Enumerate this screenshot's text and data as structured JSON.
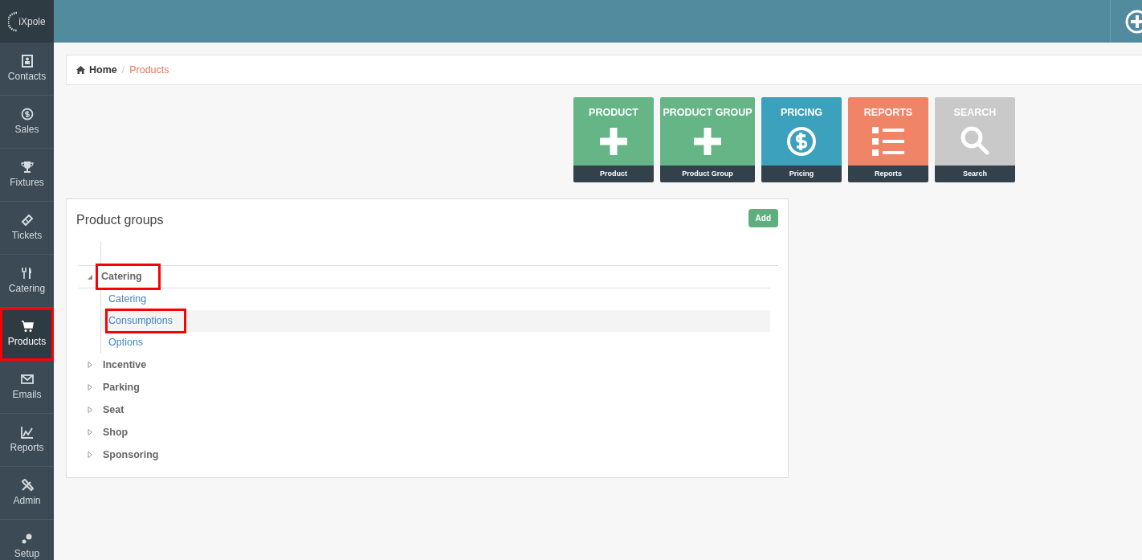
{
  "logo": {
    "text": "iXpole"
  },
  "sidebar": {
    "items": [
      {
        "label": "Contacts",
        "selected": false,
        "highlighted": false
      },
      {
        "label": "Sales",
        "selected": false,
        "highlighted": false
      },
      {
        "label": "Fixtures",
        "selected": false,
        "highlighted": false
      },
      {
        "label": "Tickets",
        "selected": false,
        "highlighted": false
      },
      {
        "label": "Catering",
        "selected": false,
        "highlighted": false
      },
      {
        "label": "Products",
        "selected": true,
        "highlighted": true
      },
      {
        "label": "Emails",
        "selected": false,
        "highlighted": false
      },
      {
        "label": "Reports",
        "selected": false,
        "highlighted": false
      },
      {
        "label": "Admin",
        "selected": false,
        "highlighted": false
      },
      {
        "label": "Setup",
        "selected": false,
        "highlighted": false
      }
    ]
  },
  "breadcrumb": {
    "separator": "/",
    "items": [
      {
        "label": "Home",
        "active": false
      },
      {
        "label": "Products",
        "active": true
      }
    ]
  },
  "tiles": [
    {
      "title": "PRODUCT",
      "caption": "Product",
      "kind": "plus",
      "color": "#66b587"
    },
    {
      "title": "PRODUCT GROUP",
      "caption": "Product Group",
      "kind": "plus",
      "color": "#66b587"
    },
    {
      "title": "PRICING",
      "caption": "Pricing",
      "kind": "dollar",
      "color": "#3ca1bc"
    },
    {
      "title": "REPORTS",
      "caption": "Reports",
      "kind": "list",
      "color": "#ef8466"
    },
    {
      "title": "SEARCH",
      "caption": "Search",
      "kind": "search",
      "color": "#c9c9c9"
    }
  ],
  "panel": {
    "title": "Product groups",
    "add_button": "Add",
    "tree": [
      {
        "label": "Catering",
        "expanded": true,
        "highlighted": true,
        "children": [
          {
            "label": "Catering",
            "selected": false,
            "highlighted": false
          },
          {
            "label": "Consumptions",
            "selected": true,
            "highlighted": true
          },
          {
            "label": "Options",
            "selected": false,
            "highlighted": false
          }
        ]
      },
      {
        "label": "Incentive",
        "expanded": false,
        "highlighted": false
      },
      {
        "label": "Parking",
        "expanded": false,
        "highlighted": false
      },
      {
        "label": "Seat",
        "expanded": false,
        "highlighted": false
      },
      {
        "label": "Shop",
        "expanded": false,
        "highlighted": false
      },
      {
        "label": "Sponsoring",
        "expanded": false,
        "highlighted": false
      }
    ]
  }
}
